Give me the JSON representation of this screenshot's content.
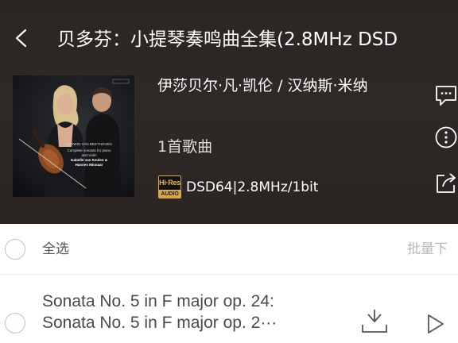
{
  "header": {
    "title": "贝多芬：小提琴奏鸣曲全集(2.8MHz DSD",
    "artist": "伊莎贝尔·凡·凯伦 / 汉纳斯·米纳",
    "track_count": "1首歌曲",
    "hires_top": "Hi·Res",
    "hires_bottom": "AUDIO",
    "format": "DSD64|2.8MHz/1bit"
  },
  "cover": {
    "line1": "LUDWIG VAN BEETHOVEN",
    "line2": "Complete sonatas for piano and violin",
    "line3": "Isabelle van Keulen & Hannes Minnaar"
  },
  "icons": {
    "back": "chevron-left-icon",
    "comment": "comment-icon",
    "more": "more-icon",
    "share": "share-icon",
    "download": "download-icon",
    "play": "play-icon"
  },
  "list": {
    "select_all": "全选",
    "batch": "批量下",
    "songs": [
      {
        "line1": "Sonata No. 5 in F major op. 24:",
        "line2": "Sonata No. 5 in F major op. 2···"
      }
    ]
  }
}
